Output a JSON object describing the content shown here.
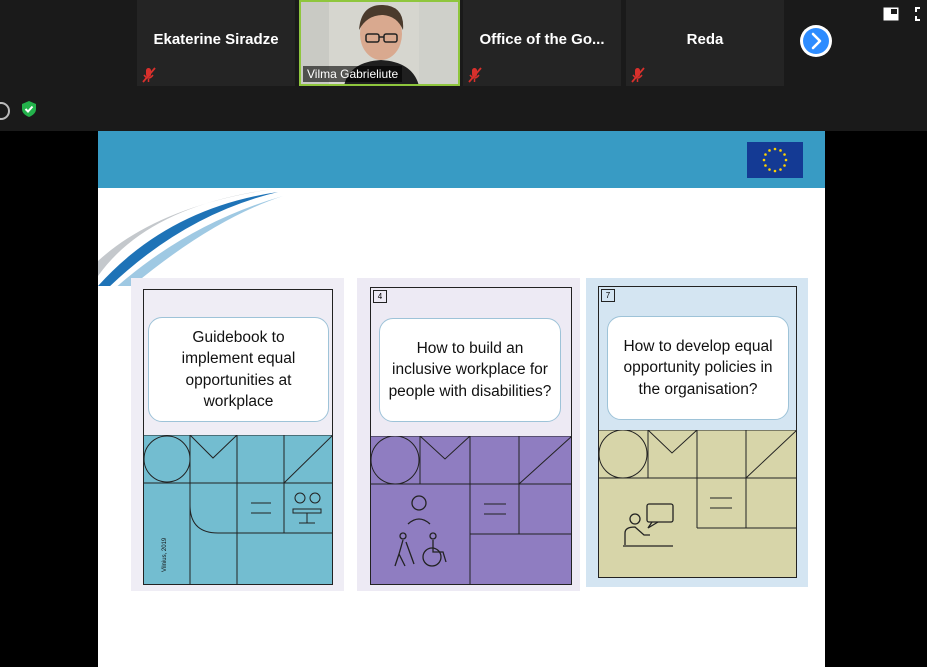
{
  "participants": [
    {
      "name": "Ekaterine Siradze",
      "muted": true
    },
    {
      "name": "Vilma Gabrieliute",
      "muted": false,
      "video": true
    },
    {
      "name": "Office of the Go...",
      "muted": true
    },
    {
      "name": "Reda",
      "muted": true
    }
  ],
  "icons": {
    "next_page": "chevron-right-icon",
    "view": "gallery-view-icon",
    "fullscreen": "fullscreen-icon",
    "info": "info-icon",
    "security": "shield-check-icon",
    "flag": "eu-flag-icon"
  },
  "colors": {
    "active_speaker_border": "#8fc63d",
    "next_button": "#2d8cff",
    "slide_header": "#389bc4",
    "eu_blue": "#143a94",
    "eu_gold": "#ffd200",
    "mute_red": "#d9302c"
  },
  "slide": {
    "cards": [
      {
        "number": "",
        "title": "Guidebook to implement equal opportunities at workplace",
        "footer_note": "Vilnius, 2019",
        "cover_color": "#73bdd0",
        "bg_color": "#efedf5"
      },
      {
        "number": "4",
        "title": "How to build an inclusive workplace for people with disabilities?",
        "footer_note": "",
        "cover_color": "#8f7dc1",
        "bg_color": "#edeaf4"
      },
      {
        "number": "7",
        "title": "How to develop equal opportunity policies in the organisation?",
        "footer_note": "",
        "cover_color": "#d7d5a9",
        "bg_color": "#d4e5f2"
      }
    ]
  }
}
